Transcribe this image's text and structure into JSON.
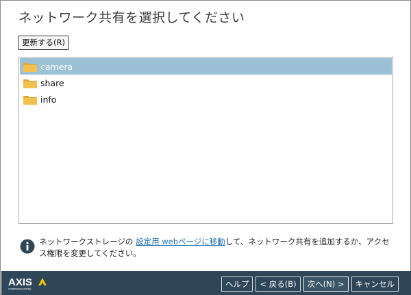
{
  "page": {
    "title": "ネットワーク共有を選択してください"
  },
  "toolbar": {
    "refresh_label": "更新する(R)"
  },
  "share_list": {
    "items": [
      {
        "name": "camera",
        "selected": true
      },
      {
        "name": "share",
        "selected": false
      },
      {
        "name": "info",
        "selected": false
      }
    ]
  },
  "info": {
    "text_before": "ネットワークストレージの ",
    "link_text": "設定用 webページに移動",
    "text_after": "して、ネットワーク共有を追加するか、アクセス権限を変更してください。"
  },
  "footer": {
    "brand": "AXIS",
    "brand_sub": "COMMUNICATIONS",
    "help_label": "ヘルプ",
    "back_label": "< 戻る(B)",
    "next_label": "次へ(N) >",
    "cancel_label": "キャンセル"
  },
  "colors": {
    "selection": "#9cc0d6",
    "footer_bg": "#2e4658",
    "folder": "#f2c04e",
    "link": "#1e6fb8",
    "logo_triangle": "#f5c400"
  },
  "icons": {
    "folder": "folder-icon",
    "info": "info-icon",
    "logo": "axis-logo"
  }
}
